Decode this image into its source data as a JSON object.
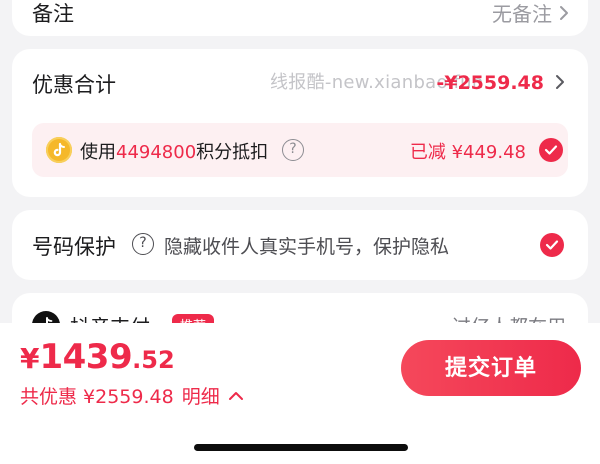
{
  "remark": {
    "label": "备注",
    "value": "无备注"
  },
  "discount": {
    "label": "优惠合计",
    "watermark": "线报酷-new.xianbao.fun",
    "amount": "-¥2559.48",
    "points": {
      "prefix": "使用",
      "count": "4494800",
      "suffix": "积分抵扣",
      "reduced": "已减 ¥449.48"
    }
  },
  "privacy": {
    "label": "号码保护",
    "description": "隐藏收件人真实手机号，保护隐私"
  },
  "payment": {
    "label": "抖音支付",
    "badge": "推荐",
    "right_text": "过亿人都在用"
  },
  "footer": {
    "price_symbol": "¥",
    "price_int": "1439",
    "price_dec": ".52",
    "saved_text": "共优惠 ¥2559.48",
    "detail_label": "明细",
    "submit_label": "提交订单"
  },
  "colors": {
    "accent": "#ee2a4a",
    "coin": "#f5b82a"
  },
  "icons": [
    "chevron-right-icon",
    "douyin-coin-icon",
    "help-circle-icon",
    "check-circle-icon",
    "douyin-logo-icon",
    "chevron-up-icon"
  ]
}
